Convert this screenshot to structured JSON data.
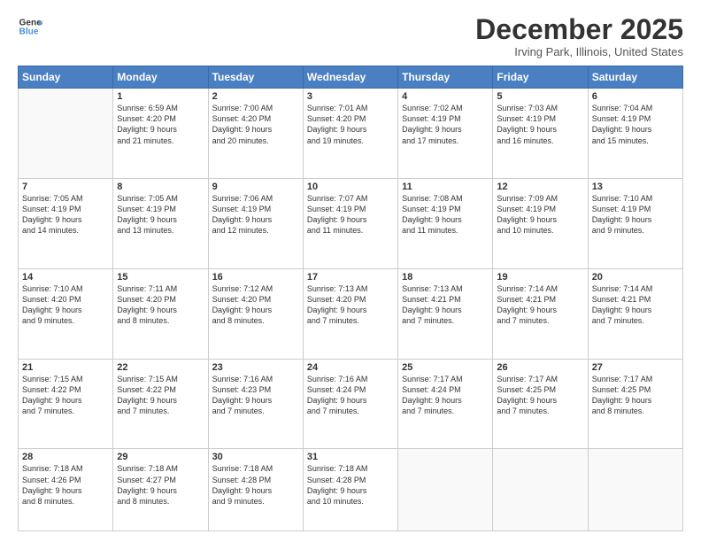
{
  "header": {
    "logo_line1": "General",
    "logo_line2": "Blue",
    "month": "December 2025",
    "location": "Irving Park, Illinois, United States"
  },
  "weekdays": [
    "Sunday",
    "Monday",
    "Tuesday",
    "Wednesday",
    "Thursday",
    "Friday",
    "Saturday"
  ],
  "weeks": [
    [
      {
        "day": "",
        "content": ""
      },
      {
        "day": "1",
        "content": "Sunrise: 6:59 AM\nSunset: 4:20 PM\nDaylight: 9 hours\nand 21 minutes."
      },
      {
        "day": "2",
        "content": "Sunrise: 7:00 AM\nSunset: 4:20 PM\nDaylight: 9 hours\nand 20 minutes."
      },
      {
        "day": "3",
        "content": "Sunrise: 7:01 AM\nSunset: 4:20 PM\nDaylight: 9 hours\nand 19 minutes."
      },
      {
        "day": "4",
        "content": "Sunrise: 7:02 AM\nSunset: 4:19 PM\nDaylight: 9 hours\nand 17 minutes."
      },
      {
        "day": "5",
        "content": "Sunrise: 7:03 AM\nSunset: 4:19 PM\nDaylight: 9 hours\nand 16 minutes."
      },
      {
        "day": "6",
        "content": "Sunrise: 7:04 AM\nSunset: 4:19 PM\nDaylight: 9 hours\nand 15 minutes."
      }
    ],
    [
      {
        "day": "7",
        "content": "Sunrise: 7:05 AM\nSunset: 4:19 PM\nDaylight: 9 hours\nand 14 minutes."
      },
      {
        "day": "8",
        "content": "Sunrise: 7:05 AM\nSunset: 4:19 PM\nDaylight: 9 hours\nand 13 minutes."
      },
      {
        "day": "9",
        "content": "Sunrise: 7:06 AM\nSunset: 4:19 PM\nDaylight: 9 hours\nand 12 minutes."
      },
      {
        "day": "10",
        "content": "Sunrise: 7:07 AM\nSunset: 4:19 PM\nDaylight: 9 hours\nand 11 minutes."
      },
      {
        "day": "11",
        "content": "Sunrise: 7:08 AM\nSunset: 4:19 PM\nDaylight: 9 hours\nand 11 minutes."
      },
      {
        "day": "12",
        "content": "Sunrise: 7:09 AM\nSunset: 4:19 PM\nDaylight: 9 hours\nand 10 minutes."
      },
      {
        "day": "13",
        "content": "Sunrise: 7:10 AM\nSunset: 4:19 PM\nDaylight: 9 hours\nand 9 minutes."
      }
    ],
    [
      {
        "day": "14",
        "content": "Sunrise: 7:10 AM\nSunset: 4:20 PM\nDaylight: 9 hours\nand 9 minutes."
      },
      {
        "day": "15",
        "content": "Sunrise: 7:11 AM\nSunset: 4:20 PM\nDaylight: 9 hours\nand 8 minutes."
      },
      {
        "day": "16",
        "content": "Sunrise: 7:12 AM\nSunset: 4:20 PM\nDaylight: 9 hours\nand 8 minutes."
      },
      {
        "day": "17",
        "content": "Sunrise: 7:13 AM\nSunset: 4:20 PM\nDaylight: 9 hours\nand 7 minutes."
      },
      {
        "day": "18",
        "content": "Sunrise: 7:13 AM\nSunset: 4:21 PM\nDaylight: 9 hours\nand 7 minutes."
      },
      {
        "day": "19",
        "content": "Sunrise: 7:14 AM\nSunset: 4:21 PM\nDaylight: 9 hours\nand 7 minutes."
      },
      {
        "day": "20",
        "content": "Sunrise: 7:14 AM\nSunset: 4:21 PM\nDaylight: 9 hours\nand 7 minutes."
      }
    ],
    [
      {
        "day": "21",
        "content": "Sunrise: 7:15 AM\nSunset: 4:22 PM\nDaylight: 9 hours\nand 7 minutes."
      },
      {
        "day": "22",
        "content": "Sunrise: 7:15 AM\nSunset: 4:22 PM\nDaylight: 9 hours\nand 7 minutes."
      },
      {
        "day": "23",
        "content": "Sunrise: 7:16 AM\nSunset: 4:23 PM\nDaylight: 9 hours\nand 7 minutes."
      },
      {
        "day": "24",
        "content": "Sunrise: 7:16 AM\nSunset: 4:24 PM\nDaylight: 9 hours\nand 7 minutes."
      },
      {
        "day": "25",
        "content": "Sunrise: 7:17 AM\nSunset: 4:24 PM\nDaylight: 9 hours\nand 7 minutes."
      },
      {
        "day": "26",
        "content": "Sunrise: 7:17 AM\nSunset: 4:25 PM\nDaylight: 9 hours\nand 7 minutes."
      },
      {
        "day": "27",
        "content": "Sunrise: 7:17 AM\nSunset: 4:25 PM\nDaylight: 9 hours\nand 8 minutes."
      }
    ],
    [
      {
        "day": "28",
        "content": "Sunrise: 7:18 AM\nSunset: 4:26 PM\nDaylight: 9 hours\nand 8 minutes."
      },
      {
        "day": "29",
        "content": "Sunrise: 7:18 AM\nSunset: 4:27 PM\nDaylight: 9 hours\nand 8 minutes."
      },
      {
        "day": "30",
        "content": "Sunrise: 7:18 AM\nSunset: 4:28 PM\nDaylight: 9 hours\nand 9 minutes."
      },
      {
        "day": "31",
        "content": "Sunrise: 7:18 AM\nSunset: 4:28 PM\nDaylight: 9 hours\nand 10 minutes."
      },
      {
        "day": "",
        "content": ""
      },
      {
        "day": "",
        "content": ""
      },
      {
        "day": "",
        "content": ""
      }
    ]
  ]
}
